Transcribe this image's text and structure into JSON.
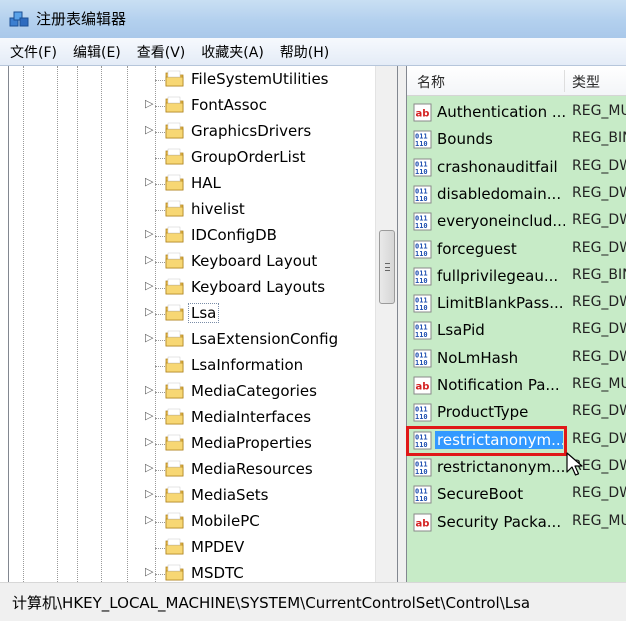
{
  "window": {
    "title": "注册表编辑器"
  },
  "menu": [
    {
      "label": "文件(F)"
    },
    {
      "label": "编辑(E)"
    },
    {
      "label": "查看(V)"
    },
    {
      "label": "收藏夹(A)"
    },
    {
      "label": "帮助(H)"
    }
  ],
  "tree": {
    "items": [
      {
        "label": "FileSystemUtilities",
        "expandable": false
      },
      {
        "label": "FontAssoc",
        "expandable": true
      },
      {
        "label": "GraphicsDrivers",
        "expandable": true
      },
      {
        "label": "GroupOrderList",
        "expandable": false
      },
      {
        "label": "HAL",
        "expandable": true
      },
      {
        "label": "hivelist",
        "expandable": false
      },
      {
        "label": "IDConfigDB",
        "expandable": true
      },
      {
        "label": "Keyboard Layout",
        "expandable": true
      },
      {
        "label": "Keyboard Layouts",
        "expandable": true
      },
      {
        "label": "Lsa",
        "expandable": true,
        "selected": true
      },
      {
        "label": "LsaExtensionConfig",
        "expandable": true
      },
      {
        "label": "LsaInformation",
        "expandable": false
      },
      {
        "label": "MediaCategories",
        "expandable": true
      },
      {
        "label": "MediaInterfaces",
        "expandable": true
      },
      {
        "label": "MediaProperties",
        "expandable": true
      },
      {
        "label": "MediaResources",
        "expandable": true
      },
      {
        "label": "MediaSets",
        "expandable": true
      },
      {
        "label": "MobilePC",
        "expandable": true
      },
      {
        "label": "MPDEV",
        "expandable": false
      },
      {
        "label": "MSDTC",
        "expandable": true
      }
    ]
  },
  "list": {
    "columns": {
      "name": "名称",
      "type": "类型"
    },
    "rows": [
      {
        "name": "Authentication ...",
        "type": "REG_MU",
        "icon": "string-value-icon"
      },
      {
        "name": "Bounds",
        "type": "REG_BIN",
        "icon": "binary-value-icon"
      },
      {
        "name": "crashonauditfail",
        "type": "REG_DW",
        "icon": "binary-value-icon"
      },
      {
        "name": "disabledomain...",
        "type": "REG_DW",
        "icon": "binary-value-icon"
      },
      {
        "name": "everyoneinclud...",
        "type": "REG_DW",
        "icon": "binary-value-icon"
      },
      {
        "name": "forceguest",
        "type": "REG_DW",
        "icon": "binary-value-icon"
      },
      {
        "name": "fullprivilegeau...",
        "type": "REG_BIN",
        "icon": "binary-value-icon"
      },
      {
        "name": "LimitBlankPass...",
        "type": "REG_DW",
        "icon": "binary-value-icon"
      },
      {
        "name": "LsaPid",
        "type": "REG_DW",
        "icon": "binary-value-icon"
      },
      {
        "name": "NoLmHash",
        "type": "REG_DW",
        "icon": "binary-value-icon"
      },
      {
        "name": "Notification Pa...",
        "type": "REG_MU",
        "icon": "string-value-icon"
      },
      {
        "name": "ProductType",
        "type": "REG_DW",
        "icon": "binary-value-icon"
      },
      {
        "name": "restrictanonym...",
        "type": "REG_DW",
        "icon": "binary-value-icon",
        "selected": true
      },
      {
        "name": "restrictanonym...",
        "type": "REG_DW",
        "icon": "binary-value-icon"
      },
      {
        "name": "SecureBoot",
        "type": "REG_DW",
        "icon": "binary-value-icon"
      },
      {
        "name": "Security Packa...",
        "type": "REG_MU",
        "icon": "string-value-icon"
      }
    ]
  },
  "status": {
    "path": "计算机\\HKEY_LOCAL_MACHINE\\SYSTEM\\CurrentControlSet\\Control\\Lsa"
  },
  "colors": {
    "list_background": "#c7ebc7",
    "selection": "#3399ff",
    "annotation_red": "#e01818"
  }
}
